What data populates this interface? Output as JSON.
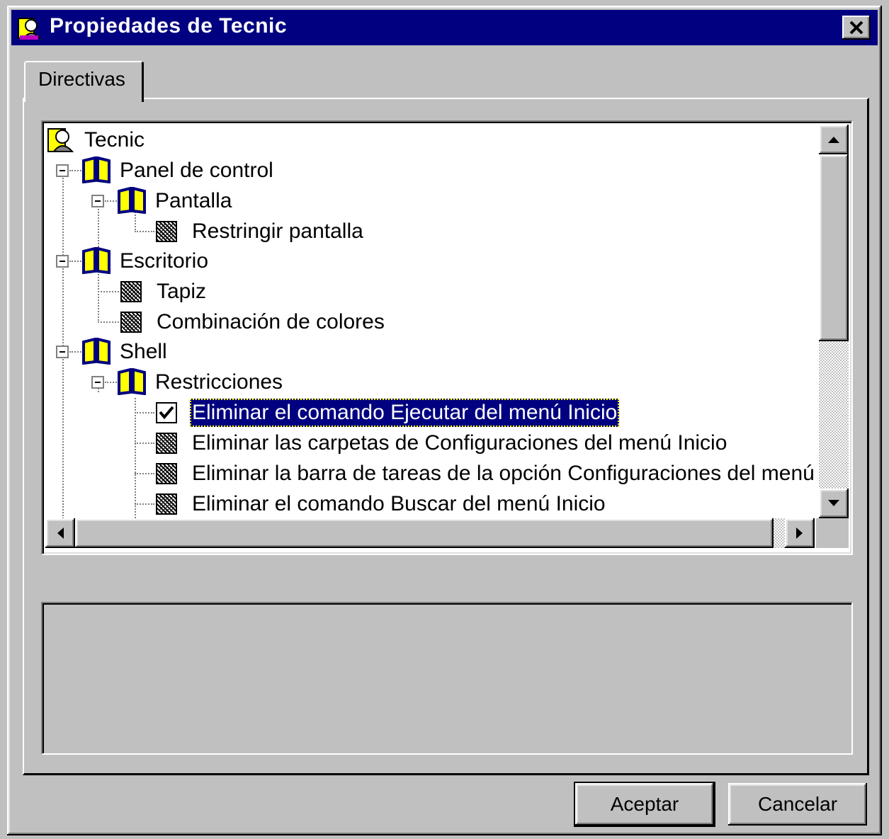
{
  "window": {
    "title": "Propiedades de Tecnic",
    "close_glyph": "✕"
  },
  "tabs": [
    {
      "label": "Directivas",
      "active": true
    }
  ],
  "tree": {
    "root": "Tecnic",
    "nodes": [
      {
        "label": "Panel de control",
        "icon": "book-icon"
      },
      {
        "label": "Pantalla",
        "icon": "book-icon"
      },
      {
        "label": "Restringir pantalla",
        "icon": "policy-grayed-icon"
      },
      {
        "label": "Escritorio",
        "icon": "book-icon"
      },
      {
        "label": "Tapiz",
        "icon": "policy-grayed-icon"
      },
      {
        "label": "Combinación de colores",
        "icon": "policy-grayed-icon"
      },
      {
        "label": "Shell",
        "icon": "book-icon"
      },
      {
        "label": "Restricciones",
        "icon": "book-icon"
      },
      {
        "label": "Eliminar el comando Ejecutar del menú Inicio",
        "icon": "checked-icon",
        "selected": true
      },
      {
        "label": "Eliminar las carpetas de Configuraciones del menú Inicio",
        "icon": "policy-grayed-icon"
      },
      {
        "label": "Eliminar la barra de tareas de la opción Configuraciones del menú Inici",
        "icon": "policy-grayed-icon"
      },
      {
        "label": "Eliminar el comando Buscar del menú Inicio",
        "icon": "policy-grayed-icon"
      }
    ]
  },
  "buttons": {
    "ok": "Aceptar",
    "cancel": "Cancelar"
  },
  "colors": {
    "titlebar": "#000080",
    "selection": "#000080",
    "face": "#c0c0c0"
  }
}
